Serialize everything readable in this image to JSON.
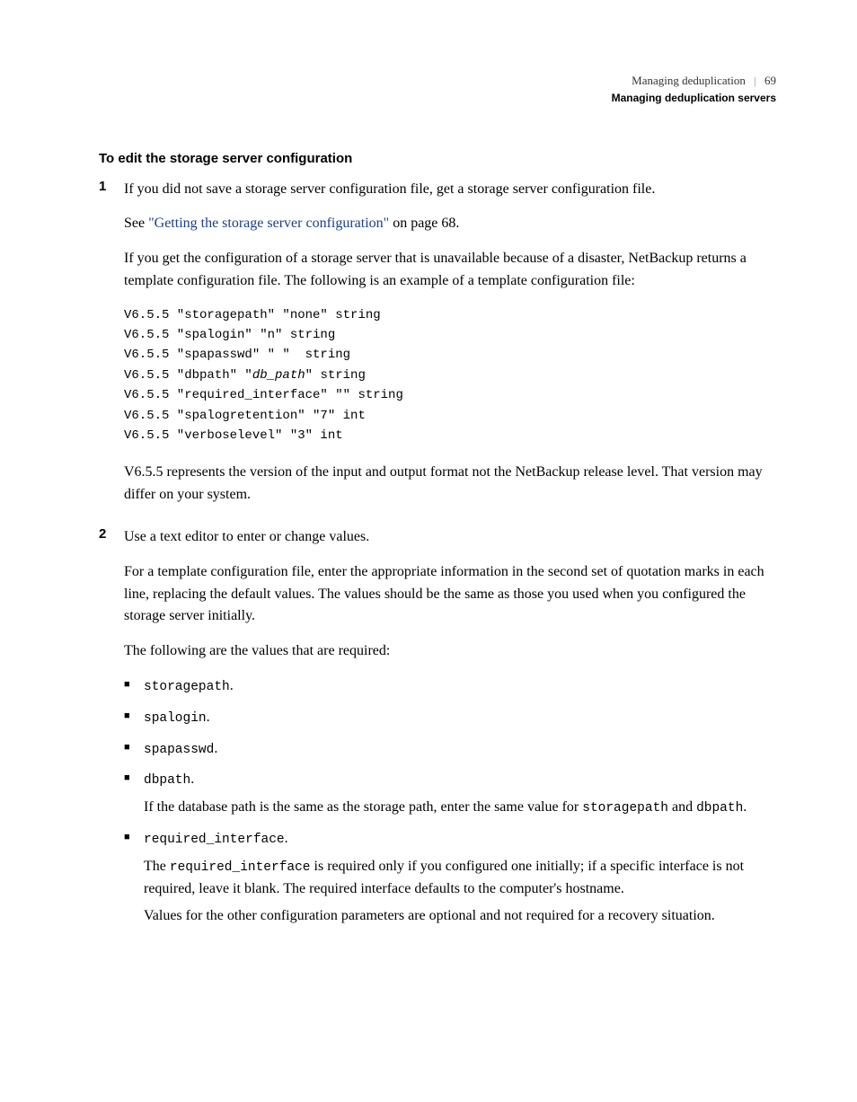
{
  "header": {
    "chapter": "Managing deduplication",
    "pagenum": "69",
    "section": "Managing deduplication servers"
  },
  "title": "To edit the storage server configuration",
  "step1": {
    "num": "1",
    "p1": "If you did not save a storage server configuration file, get a storage server configuration file.",
    "see_prefix": "See ",
    "link_text": "\"Getting the storage server configuration\"",
    "see_suffix": " on page 68.",
    "p3": "If you get the configuration of a storage server that is unavailable because of a disaster, NetBackup returns a template configuration file. The following is an example of a template configuration file:",
    "code_l1": "V6.5.5 \"storagepath\" \"none\" string",
    "code_l2": "V6.5.5 \"spalogin\" \"n\" string",
    "code_l3": "V6.5.5 \"spapasswd\" \" \"  string",
    "code_l4a": "V6.5.5 \"dbpath\" \"",
    "code_l4b": "db_path",
    "code_l4c": "\" string",
    "code_l5": "V6.5.5 \"required_interface\" \"\" string",
    "code_l6": "V6.5.5 \"spalogretention\" \"7\" int",
    "code_l7": "V6.5.5 \"verboselevel\" \"3\" int",
    "p4": "V6.5.5 represents the version of the input and output format not the NetBackup release level. That version may differ on your system."
  },
  "step2": {
    "num": "2",
    "p1": "Use a text editor to enter or change values.",
    "p2": "For a template configuration file, enter the appropriate information in the second set of quotation marks in each line, replacing the default values. The values should be the same as those you used when you configured the storage server initially.",
    "p3": "The following are the values that are required:",
    "b1": "storagepath",
    "b2": "spalogin",
    "b3": "spapasswd",
    "b4": "dbpath",
    "b4_sub_a": "If the database path is the same as the storage path, enter the same value for ",
    "b4_sub_code1": "storagepath",
    "b4_sub_and": " and ",
    "b4_sub_code2": "dbpath",
    "b5": "required_interface",
    "b5_sub1_a": "The ",
    "b5_sub1_code": "required_interface",
    "b5_sub1_b": " is required only if you configured one initially; if a specific interface is not required, leave it blank. The required interface defaults to the computer's hostname.",
    "b5_sub2": "Values for the other configuration parameters are optional and not required for a recovery situation.",
    "dot": "."
  }
}
